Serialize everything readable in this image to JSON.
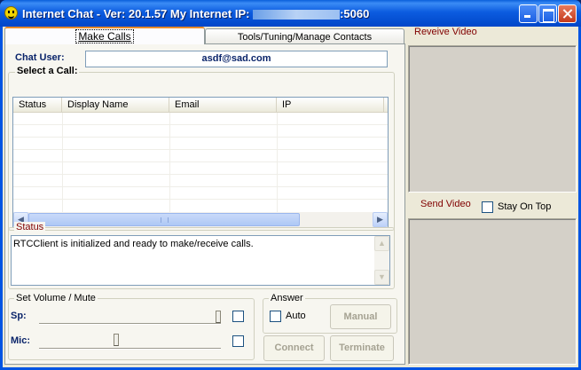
{
  "window": {
    "title_prefix": "Internet Chat - Ver: 20.1.57 My Internet IP:",
    "ip_suffix": ":5060"
  },
  "tabs": [
    {
      "label": "Make Calls"
    },
    {
      "label": "Tools/Tuning/Manage Contacts"
    }
  ],
  "make_calls": {
    "chat_user_label": "Chat User:",
    "chat_user_value": "asdf@sad.com",
    "select_call_label": "Select a Call:",
    "columns": [
      "Status",
      "Display Name",
      "Email",
      "IP"
    ],
    "status_group_label": "Status",
    "status_text": "RTCClient is initialized and ready to make/receive calls.",
    "volume_group_label": "Set Volume / Mute",
    "speaker_label": "Sp:",
    "mic_label": "Mic:",
    "speaker_level_percent": 100,
    "mic_level_percent": 42,
    "answer_group_label": "Answer",
    "auto_label": "Auto",
    "manual_button": "Manual",
    "connect_button": "Connect",
    "terminate_button": "Terminate"
  },
  "video": {
    "receive_label": "Reveive Video",
    "send_label": "Send Video",
    "stay_on_top_label": "Stay On Top"
  }
}
